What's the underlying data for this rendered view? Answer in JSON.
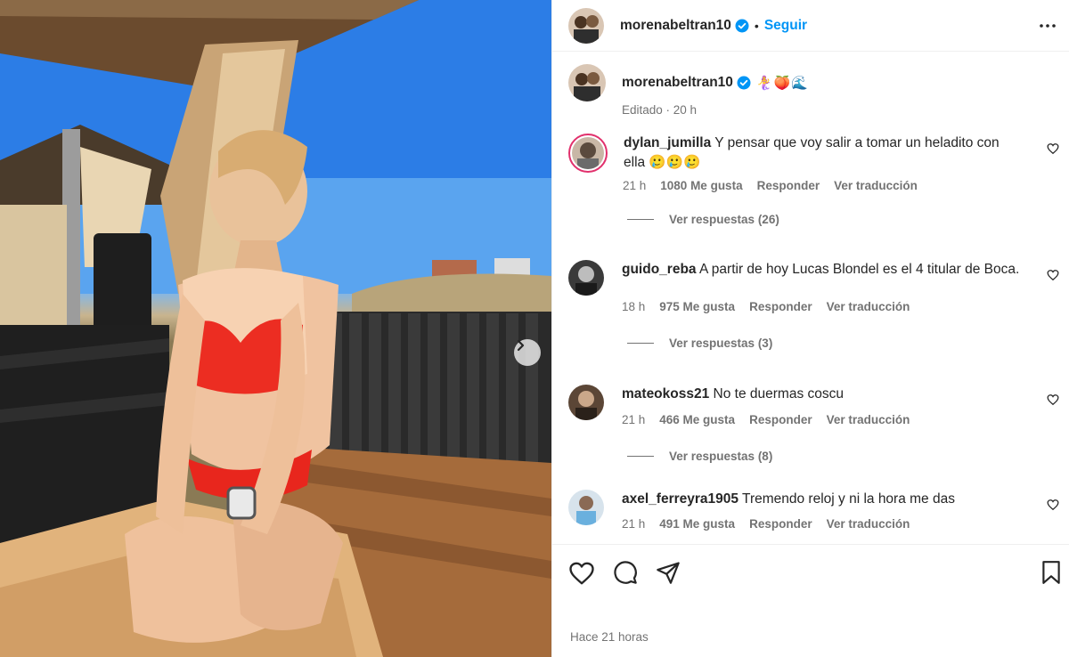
{
  "header": {
    "username": "morenabeltran10",
    "separator": "•",
    "follow_label": "Seguir"
  },
  "caption": {
    "username": "morenabeltran10",
    "text": "🧜‍♀️🍑🌊",
    "meta": "Editado · 20 h"
  },
  "comments": [
    {
      "username": "dylan_jumilla",
      "text": "Y pensar que voy salir a tomar un heladito con ella 🥲🥲🥲",
      "time": "21 h",
      "likes": "1080 Me gusta",
      "reply_label": "Responder",
      "translate_label": "Ver traducción",
      "replies_label": "Ver respuestas (26)"
    },
    {
      "username": "guido_reba",
      "text": "A partir de hoy Lucas Blondel es el 4 titular de Boca.",
      "time": "18 h",
      "likes": "975 Me gusta",
      "reply_label": "Responder",
      "translate_label": "Ver traducción",
      "replies_label": "Ver respuestas (3)"
    },
    {
      "username": "mateokoss21",
      "text": "No te duermas coscu",
      "time": "21 h",
      "likes": "466 Me gusta",
      "reply_label": "Responder",
      "translate_label": "Ver traducción",
      "replies_label": "Ver respuestas (8)"
    },
    {
      "username": "axel_ferreyra1905",
      "text": "Tremendo reloj y ni la hora me das",
      "time": "21 h",
      "likes": "491 Me gusta",
      "reply_label": "Responder",
      "translate_label": "Ver traducción"
    }
  ],
  "footer": {
    "posted_ago": "Hace 21 horas"
  },
  "icons": {
    "verified": "verified-badge-icon",
    "more": "more-options-icon",
    "like": "heart-icon",
    "comment": "comment-bubble-icon",
    "share": "paper-plane-icon",
    "save": "bookmark-icon",
    "next": "chevron-right-icon"
  },
  "colors": {
    "accent": "#0095f6",
    "text": "#262626",
    "muted": "#737373",
    "divider": "#efefef"
  }
}
